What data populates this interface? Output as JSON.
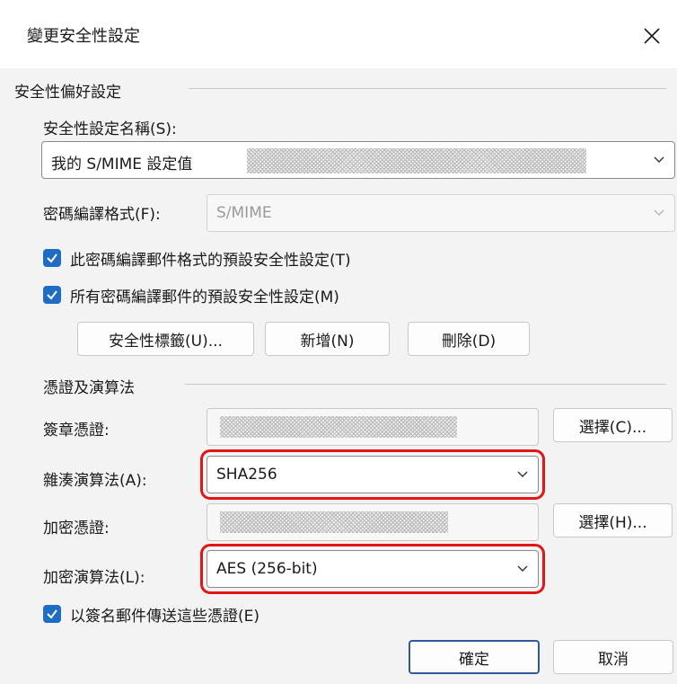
{
  "title": "變更安全性設定",
  "close_label": "×",
  "pref": {
    "group_title": "安全性偏好設定",
    "name_label": "安全性設定名稱(S):",
    "name_value": "我的 S/MIME 設定值",
    "format_label": "密碼編譯格式(F):",
    "format_value": "S/MIME",
    "check1": "此密碼編譯郵件格式的預設安全性設定(T)",
    "check2": "所有密碼編譯郵件的預設安全性設定(M)",
    "btn_label_security": "安全性標籤(U)...",
    "btn_new": "新增(N)",
    "btn_delete": "刪除(D)"
  },
  "certs": {
    "group_title": "憑證及演算法",
    "sign_cert_label": "簽章憑證:",
    "hash_label": "雜湊演算法(A):",
    "hash_value": "SHA256",
    "enc_cert_label": "加密憑證:",
    "enc_alg_label": "加密演算法(L):",
    "enc_alg_value": "AES (256-bit)",
    "choose_sign": "選擇(C)...",
    "choose_enc": "選擇(H)...",
    "send_certs_label": "以簽名郵件傳送這些憑證(E)"
  },
  "buttons": {
    "ok": "確定",
    "cancel": "取消"
  },
  "colors": {
    "accent": "#1f6cc4",
    "highlight": "#e11616"
  }
}
